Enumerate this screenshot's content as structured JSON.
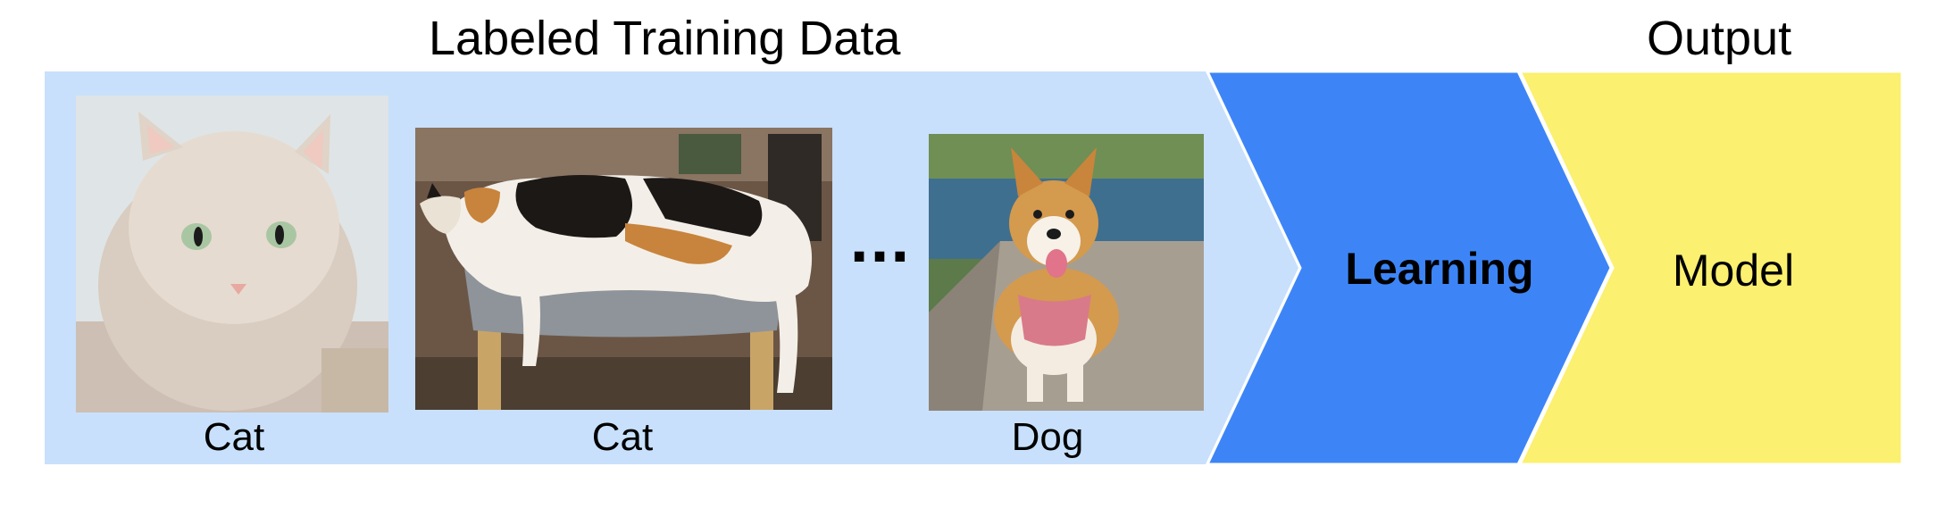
{
  "titles": {
    "training_data": "Labeled Training Data",
    "output": "Output"
  },
  "examples": [
    {
      "label": "Cat",
      "image": "cat-portrait-photo"
    },
    {
      "label": "Cat",
      "image": "calico-cat-on-stool-photo"
    },
    {
      "label": "Dog",
      "image": "corgi-dog-photo"
    }
  ],
  "ellipsis": "···",
  "stages": {
    "learning": "Learning",
    "model": "Model"
  },
  "colors": {
    "training_panel": "#c8e0fb",
    "learning_arrow": "#3d85f7",
    "model_box": "#fbf06f",
    "cat1_bg": "#dfe4e6",
    "cat1_fur": "#d9ccc0",
    "cat2_bg": "#6b5646",
    "cat2_fur_white": "#f3efe8",
    "cat2_patch_black": "#1c1816",
    "cat2_patch_orange": "#c8843c",
    "dog_bg": "#5d7a4a",
    "dog_water": "#3f6f8f",
    "dog_path": "#a79e92",
    "dog_fur": "#d49a4e",
    "dog_harness": "#d97a8a"
  }
}
